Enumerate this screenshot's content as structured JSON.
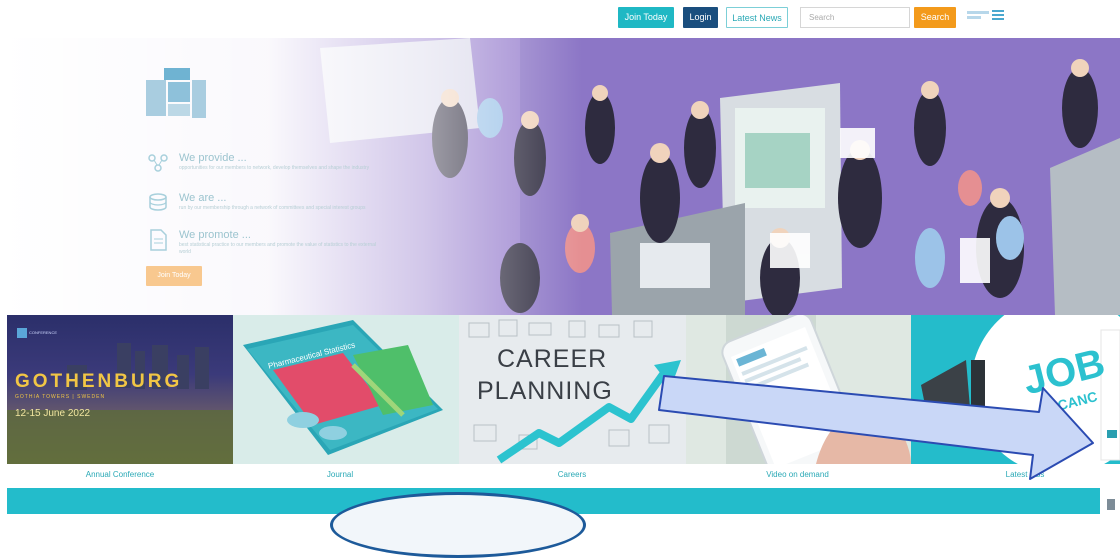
{
  "header": {
    "join_label": "Join Today",
    "login_label": "Login",
    "news_label": "Latest News",
    "search_placeholder": "Search",
    "search_label": "Search"
  },
  "hero": {
    "features": [
      {
        "title": "We provide ...",
        "desc": "opportunities for our members to network, develop themselves and shape the industry",
        "icon": "network-icon"
      },
      {
        "title": "We are ...",
        "desc": "run by our membership through a network of committees and special interest groups",
        "icon": "database-icon"
      },
      {
        "title": "We promote ...",
        "desc": "best statistical practice to our members and promote the value of statistics to the external world",
        "icon": "document-icon"
      }
    ],
    "cta_label": "Join Today"
  },
  "tiles": [
    {
      "label": "Annual Conference",
      "city": "GOTHENBURG",
      "venue": "GOTHIA TOWERS | SWEDEN",
      "dates": "12-15 June 2022",
      "badge": "CONFERENCE"
    },
    {
      "label": "Journal",
      "cover_title": "Pharmaceutical Statistics"
    },
    {
      "label": "Careers",
      "line1": "CAREER",
      "line2": "PLANNING"
    },
    {
      "label": "Video on demand"
    },
    {
      "label": "Latest jobs",
      "text": "JOB",
      "text2": "VACANC"
    }
  ],
  "colors": {
    "teal": "#23bccb",
    "navy": "#1a4e7e",
    "orange": "#f39a1b",
    "arrow_fill": "#c9d7f7",
    "arrow_stroke": "#2b4bb2"
  }
}
